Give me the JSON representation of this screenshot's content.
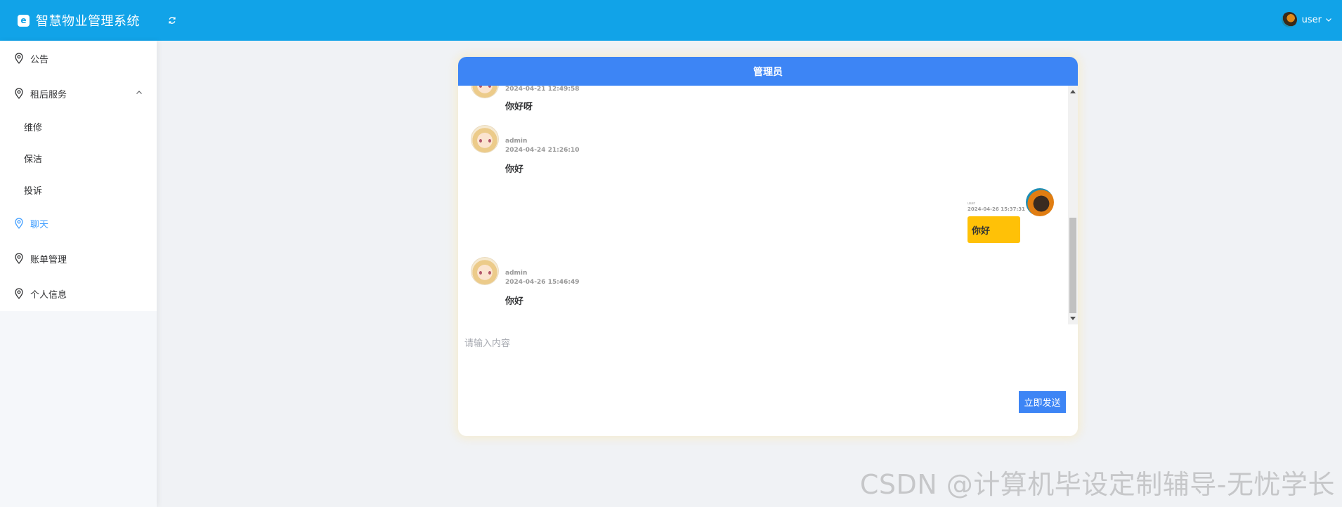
{
  "header": {
    "app_title": "智慧物业管理系统",
    "user_name": "user",
    "bg_color": "#11a3e8"
  },
  "sidebar": {
    "items": [
      {
        "label": "公告"
      },
      {
        "label": "租后服务",
        "expanded": true,
        "children": [
          {
            "label": "维修"
          },
          {
            "label": "保洁"
          },
          {
            "label": "投诉"
          }
        ]
      },
      {
        "label": "聊天",
        "active": true
      },
      {
        "label": "账单管理"
      },
      {
        "label": "个人信息"
      }
    ],
    "active_color": "#409eff"
  },
  "chat": {
    "title": "管理员",
    "header_color": "#3d85f5",
    "messages": [
      {
        "side": "left",
        "time": "2024-04-21 12:49:58",
        "text": "你好呀"
      },
      {
        "side": "left",
        "sender": "admin",
        "time": "2024-04-24 21:26:10",
        "text": "你好"
      },
      {
        "side": "right",
        "sender": "user",
        "time": "2024-04-26 15:37:31",
        "text": "你好",
        "bubble_color": "#ffc107"
      },
      {
        "side": "left",
        "sender": "admin",
        "time": "2024-04-26 15:46:49",
        "text": "你好"
      }
    ],
    "input": {
      "placeholder": "请输入内容",
      "value": ""
    },
    "send_label": "立即发送"
  },
  "watermark": "CSDN @计算机毕设定制辅导-无忧学长"
}
